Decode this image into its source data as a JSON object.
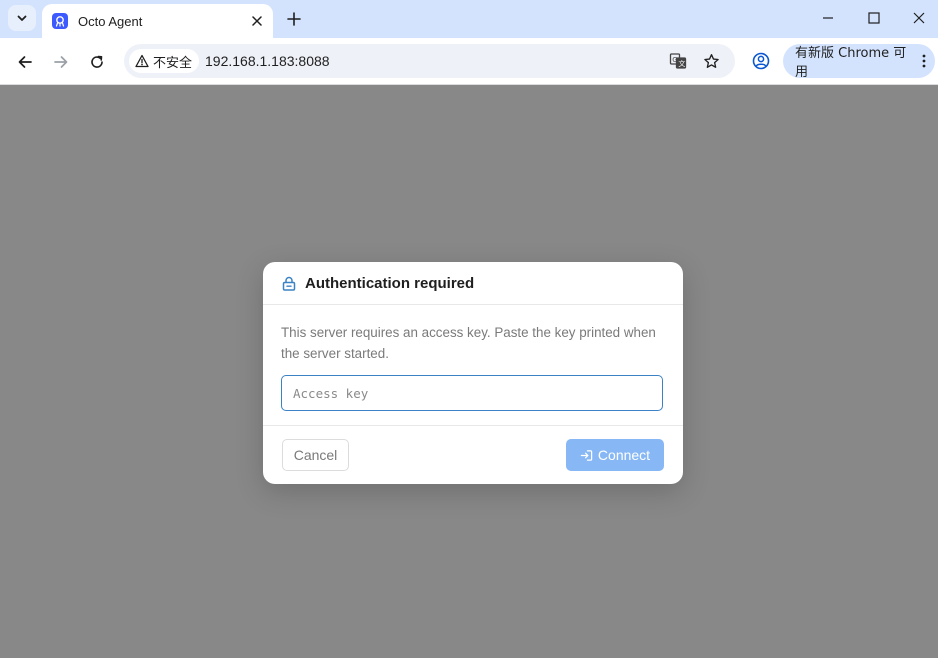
{
  "tab": {
    "title": "Octo Agent"
  },
  "omnibox": {
    "security_label": "不安全",
    "url": "192.168.1.183:8088"
  },
  "update_chip": {
    "label": "有新版 Chrome 可用"
  },
  "dialog": {
    "title": "Authentication required",
    "description": "This server requires an access key. Paste the key printed when the server started.",
    "input": {
      "placeholder": "Access key",
      "value": ""
    },
    "cancel_label": "Cancel",
    "connect_label": "Connect"
  },
  "colors": {
    "tabstrip": "#d3e3fd",
    "overlay": "#888888",
    "accent": "#3b82c4",
    "connect_disabled": "#87b8f5"
  },
  "icons": [
    "tab-search-icon",
    "octo-favicon-icon",
    "close-icon",
    "plus-icon",
    "minimize-icon",
    "maximize-icon",
    "back-arrow-icon",
    "forward-arrow-icon",
    "reload-icon",
    "warning-icon",
    "translate-icon",
    "star-icon",
    "profile-icon",
    "kebab-menu-icon",
    "lock-icon",
    "login-icon"
  ]
}
